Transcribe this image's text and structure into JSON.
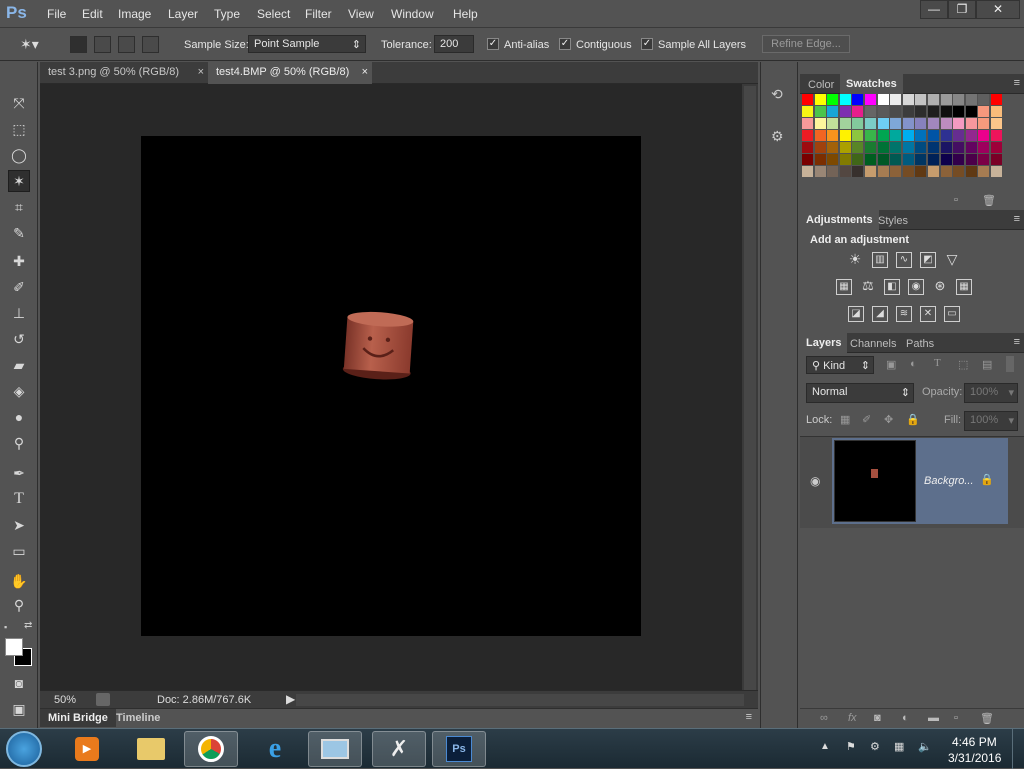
{
  "app": {
    "logo": "Ps"
  },
  "menu": [
    "File",
    "Edit",
    "Image",
    "Layer",
    "Type",
    "Select",
    "Filter",
    "View",
    "Window",
    "Help"
  ],
  "window_controls": {
    "minimize": "—",
    "restore": "❐",
    "close": "✕"
  },
  "options": {
    "sample_size_label": "Sample Size:",
    "sample_size_value": "Point Sample",
    "tolerance_label": "Tolerance:",
    "tolerance_value": "200",
    "anti_alias": "Anti-alias",
    "contiguous": "Contiguous",
    "sample_all_layers": "Sample All Layers",
    "refine_edge": "Refine Edge..."
  },
  "tabs": [
    {
      "label": "test 3.png @ 50% (RGB/8)",
      "close": "×"
    },
    {
      "label": "test4.BMP @ 50% (RGB/8)",
      "close": "×"
    }
  ],
  "status": {
    "zoom": "50%",
    "doc": "Doc: 2.86M/767.6K"
  },
  "bottom_tabs": [
    "Mini Bridge",
    "Timeline"
  ],
  "panels": {
    "color_tabs": [
      "Color",
      "Swatches"
    ],
    "adjust_tabs": [
      "Adjustments",
      "Styles"
    ],
    "add_adjustment": "Add an adjustment",
    "layers_tabs": [
      "Layers",
      "Channels",
      "Paths"
    ],
    "kind": "Kind",
    "blend_mode": "Normal",
    "opacity_label": "Opacity:",
    "opacity_value": "100%",
    "lock_label": "Lock:",
    "fill_label": "Fill:",
    "fill_value": "100%",
    "layer_name": "Backgro..."
  },
  "clock": {
    "time": "4:46 PM",
    "date": "3/31/2016"
  },
  "swatch_colors": [
    [
      "#ff0000",
      "#ffff00",
      "#00ff00",
      "#00ffff",
      "#0000ff",
      "#ff00ff",
      "#ffffff",
      "#ebebeb",
      "#d7d7d7",
      "#c3c3c3",
      "#afafaf",
      "#9b9b9b",
      "#878787",
      "#737373",
      "#5f5f5f",
      "#ff0000"
    ],
    [
      "#f7f715",
      "#4bc44b",
      "#17a6d6",
      "#7d2fb0",
      "#e61e8c",
      "#666666",
      "#5a5a5a",
      "#4b4b4b",
      "#3c3c3c",
      "#2d2d2d",
      "#1e1e1e",
      "#0f0f0f",
      "#000000",
      "#000000",
      "#f7987d",
      "#fabc7a"
    ],
    [
      "#f79a9a",
      "#fdf59c",
      "#c3df9a",
      "#a2d39c",
      "#82ca9c",
      "#7bcdc8",
      "#6ecff6",
      "#7ea7d8",
      "#8393ca",
      "#8781bd",
      "#a187be",
      "#bd8cbf",
      "#f49ac1",
      "#f6989d",
      "#f79a7d",
      "#fdc68a"
    ],
    [
      "#ed1c24",
      "#f26522",
      "#f7941d",
      "#fff200",
      "#8dc63f",
      "#39b54a",
      "#00a651",
      "#00a99d",
      "#00aeef",
      "#0072bc",
      "#0054a6",
      "#2e3192",
      "#662d91",
      "#92278f",
      "#ec008c",
      "#ed145b"
    ],
    [
      "#9e0b0f",
      "#a0410d",
      "#a36209",
      "#aba000",
      "#598527",
      "#1a7b30",
      "#007236",
      "#00746b",
      "#0076a3",
      "#004b80",
      "#003471",
      "#1b1464",
      "#440e62",
      "#630460",
      "#9e005d",
      "#9e0039"
    ],
    [
      "#790000",
      "#7b2e00",
      "#7d4900",
      "#827b00",
      "#406618",
      "#005e20",
      "#005826",
      "#005952",
      "#005b7f",
      "#003663",
      "#002157",
      "#0d004c",
      "#32004b",
      "#4b0049",
      "#7b0046",
      "#7a0026"
    ],
    [
      "#c7b299",
      "#998675",
      "#736357",
      "#534741",
      "#37302d",
      "#c69c6d",
      "#a67c52",
      "#8c6239",
      "#754c24",
      "#603913",
      "#c69c6d",
      "#8c6239",
      "#754c24",
      "#603913",
      "#a67c52",
      "#c7b299"
    ]
  ]
}
